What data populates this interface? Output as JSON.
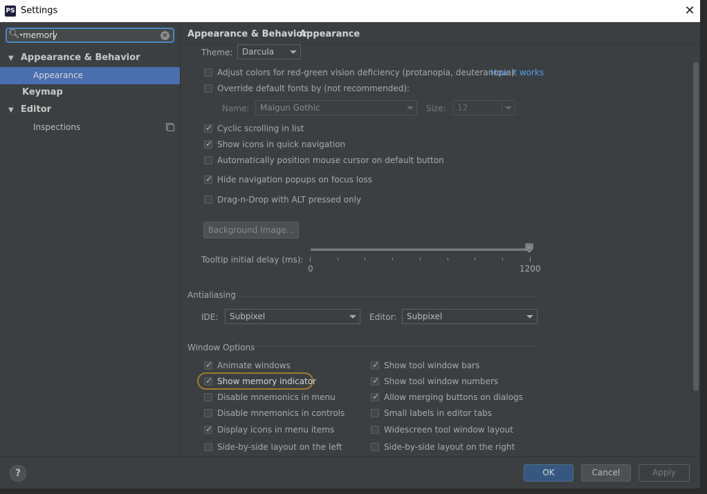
{
  "window": {
    "title": "Settings",
    "app_icon": "PS",
    "close": "✕"
  },
  "search": {
    "value": "memory"
  },
  "tree": {
    "items": [
      {
        "label": "Appearance & Behavior",
        "arrow": "▼"
      },
      {
        "label": "Appearance"
      },
      {
        "label": "Keymap"
      },
      {
        "label": "Editor",
        "arrow": "▼"
      },
      {
        "label": "Inspections"
      }
    ]
  },
  "breadcrumb": {
    "parent": "Appearance & Behavior",
    "sep": "›",
    "current": "Appearance"
  },
  "theme": {
    "label": "Theme:",
    "value": "Darcula"
  },
  "options": {
    "colorblind": {
      "label": "Adjust colors for red-green vision deficiency (protanopia, deuteranopia)",
      "checked": false,
      "link": "How it works"
    },
    "override_fonts": {
      "label": "Override default fonts by (not recommended):",
      "checked": false
    },
    "font_name_label": "Name:",
    "font_name": "Malgun Gothic",
    "font_size_label": "Size:",
    "font_size": "12",
    "cyclic": {
      "label": "Cyclic scrolling in list",
      "checked": true
    },
    "icons_quick": {
      "label": "Show icons in quick navigation",
      "checked": true
    },
    "auto_mouse": {
      "label": "Automatically position mouse cursor on default button",
      "checked": false
    },
    "hide_popups": {
      "label": "Hide navigation popups on focus loss",
      "checked": true
    },
    "dnd_alt": {
      "label": "Drag-n-Drop with ALT pressed only",
      "checked": false
    },
    "background_image": "Background Image...",
    "tooltip_label": "Tooltip initial delay (ms):",
    "tooltip_min": "0",
    "tooltip_max": "1200",
    "tooltip_value_fraction": 1.0
  },
  "antialiasing": {
    "title": "Antialiasing",
    "ide_label": "IDE:",
    "ide_value": "Subpixel",
    "editor_label": "Editor:",
    "editor_value": "Subpixel"
  },
  "window_options": {
    "title": "Window Options",
    "left": [
      {
        "label": "Animate windows",
        "checked": true
      },
      {
        "label": "Show memory indicator",
        "checked": true
      },
      {
        "label": "Disable mnemonics in menu",
        "checked": false
      },
      {
        "label": "Disable mnemonics in controls",
        "checked": false
      },
      {
        "label": "Display icons in menu items",
        "checked": true
      },
      {
        "label": "Side-by-side layout on the left",
        "checked": false
      }
    ],
    "right": [
      {
        "label": "Show tool window bars",
        "checked": true
      },
      {
        "label": "Show tool window numbers",
        "checked": true
      },
      {
        "label": "Allow merging buttons on dialogs",
        "checked": true
      },
      {
        "label": "Small labels in editor tabs",
        "checked": false
      },
      {
        "label": "Widescreen tool window layout",
        "checked": false
      },
      {
        "label": "Side-by-side layout on the right",
        "checked": false
      }
    ]
  },
  "footer": {
    "help": "?",
    "ok": "OK",
    "cancel": "Cancel",
    "apply": "Apply"
  }
}
